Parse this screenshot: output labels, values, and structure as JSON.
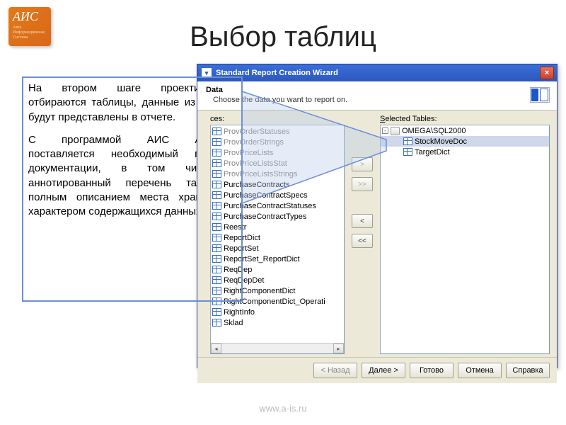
{
  "logo_text": "АИС",
  "logo_sub": "Авто Информационная Система",
  "page_title": "Выбор таблиц",
  "body_p1": "На втором шаге проектирования отбираются таблицы, данные из которых будут представлены в отчете.",
  "body_p2": "С программой АИС Аптекарь поставляется необходимый перечень документации, в том числе и аннотированный перечень таблиц с полным описанием места хранения и характером содержащихся данных.",
  "dialog": {
    "title": "Standard Report Creation Wizard",
    "header_title": "Data",
    "header_sub": "Choose the data you want to report on.",
    "sources_label_pre": "ces:",
    "selected_label": "Selected Tables:",
    "available": [
      "ProvOrderStatuses",
      "ProvOrderStrings",
      "ProvPriceLists",
      "ProvPriceListsStat",
      "ProvPriceListsStrings",
      "PurchaseContracts",
      "PurchaseContractSpecs",
      "PurchaseContractStatuses",
      "PurchaseContractTypes",
      "Reestr",
      "ReportDict",
      "ReportSet",
      "ReportSet_ReportDict",
      "ReqDep",
      "ReqDepDet",
      "RightComponentDict",
      "RightComponentDict_Operati",
      "RightInfo",
      "Sklad"
    ],
    "greyed_until": 5,
    "selected_root": "OMEGA\\SQL2000",
    "selected_items": [
      "StockMoveDoc",
      "TargetDict"
    ],
    "buttons": {
      "back": "< Назад",
      "next": "Далее >",
      "finish": "Готово",
      "cancel": "Отмена",
      "help": "Справка"
    },
    "mid": {
      "add": ">",
      "addall": ">>",
      "rem": "<",
      "remall": "<<"
    }
  },
  "footer_url": "www.a-is.ru"
}
